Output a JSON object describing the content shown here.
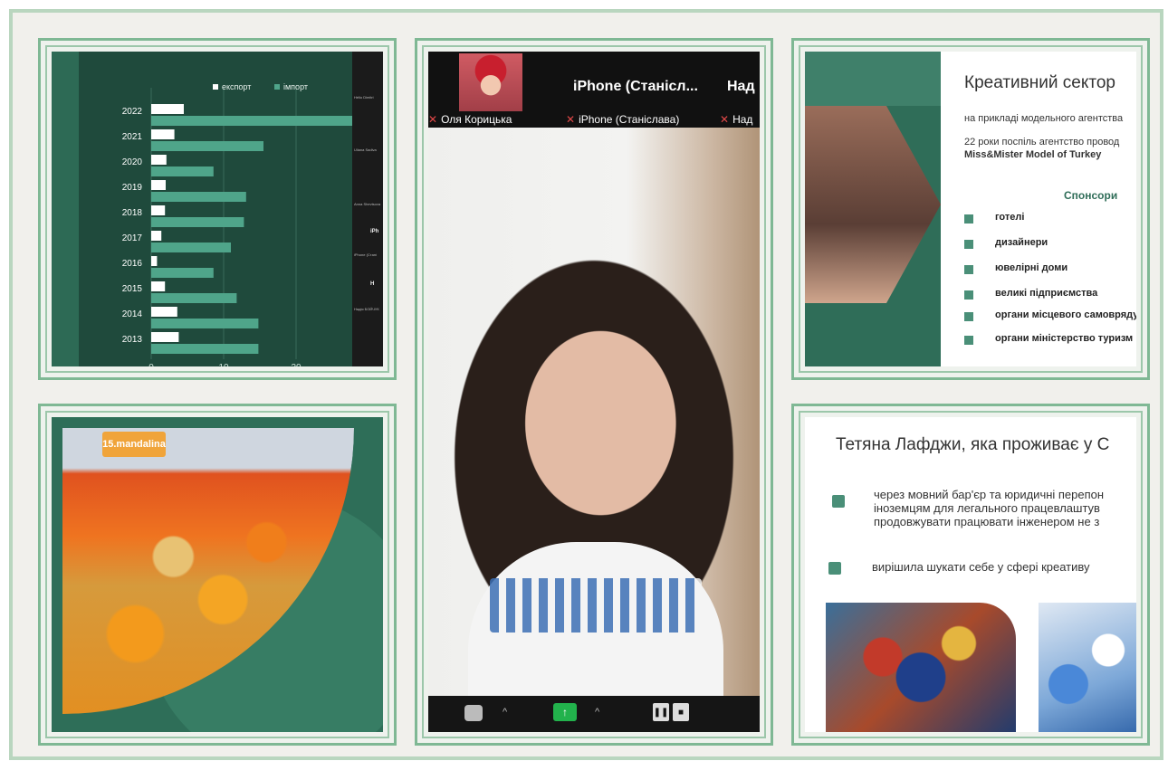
{
  "chart_data": {
    "type": "bar",
    "orientation": "horizontal",
    "categories": [
      "2022",
      "2021",
      "2020",
      "2019",
      "2018",
      "2017",
      "2016",
      "2015",
      "2014",
      "2013"
    ],
    "series": [
      {
        "name": "експорт",
        "values": [
          4.5,
          3.2,
          2.1,
          2.0,
          1.9,
          1.4,
          0.8,
          1.9,
          3.6,
          3.8
        ]
      },
      {
        "name": "імпорт",
        "values": [
          32,
          15.5,
          8.6,
          13.1,
          12.8,
          11.0,
          8.6,
          11.8,
          14.8,
          14.8
        ]
      }
    ],
    "xlim": [
      0,
      30
    ],
    "xticks": [
      "0",
      "10",
      "20",
      "30"
    ],
    "legend": "top",
    "colors": {
      "export": "#ffffff",
      "import": "#4fa58a",
      "background": "#1f4a3c",
      "grid": "#3a6b5a"
    }
  },
  "chart_thumbs": [
    "Hélio Dimitri",
    "Uliana Sadiva",
    "Anna Shevtsova",
    "iPhone (Стані",
    "Надія БОЙЧУК"
  ],
  "chart_thumbs_strong": [
    "iPh",
    "H"
  ],
  "orange_photo": {
    "banner": "15.mandalina"
  },
  "video": {
    "participant1": {
      "name": "Оля Корицька"
    },
    "participant2": {
      "title": "iPhone (Станісл...",
      "name": "iPhone (Станіслава)"
    },
    "participant3": {
      "title": "Над",
      "name": "Над"
    },
    "controls": {
      "share_arrow": "↑",
      "caret": "^",
      "pause": "❚❚",
      "stop": "■"
    }
  },
  "slide_creative": {
    "title": "Креативний сектор",
    "line1": "на прикладі модельного агентства",
    "line2": "22 роки поспіль агентство провод",
    "line3": "Miss&Mister Model of Turkey",
    "sponsors_heading": "Спонсори",
    "sponsors": [
      "готелі",
      "дизайнери",
      "ювелірні доми",
      "великі підприємства",
      "органи місцевого самовряду",
      "органи міністерство туризм"
    ]
  },
  "slide_tetiana": {
    "title": "Тетяна Лафджи, яка проживає у С",
    "bullet1_lines": [
      "через мовний бар'єр та юридичні перепон",
      "іноземцям для легального працевлаштув",
      "продовжувати працювати інженером не з"
    ],
    "bullet2": "вирішила шукати себе у сфері креативу"
  },
  "colors": {
    "accent_green": "#4a8f78",
    "frame_green": "#7fb894",
    "mic_off_red": "#e04848",
    "share_green": "#22b24c"
  }
}
